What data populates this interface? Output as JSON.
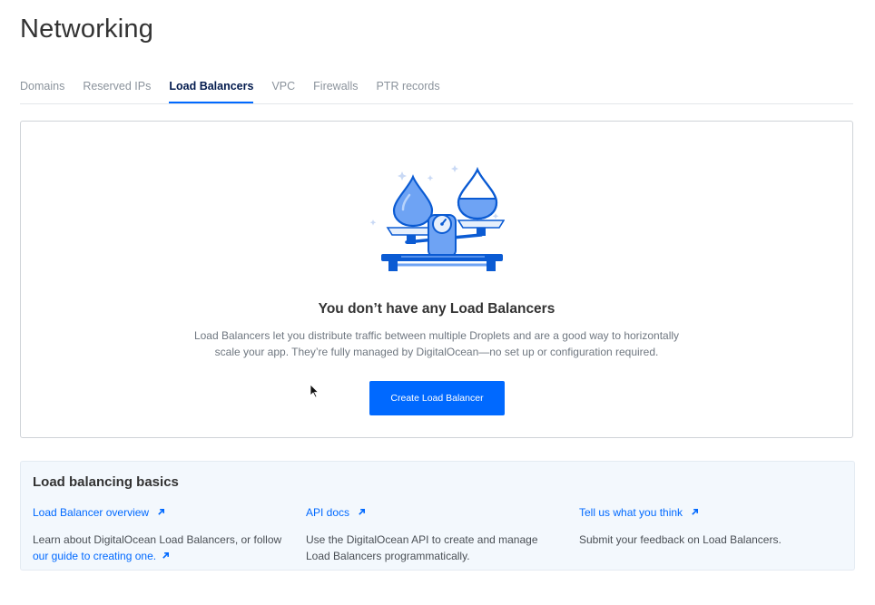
{
  "page": {
    "title": "Networking"
  },
  "tabs": [
    {
      "label": "Domains",
      "active": false
    },
    {
      "label": "Reserved IPs",
      "active": false
    },
    {
      "label": "Load Balancers",
      "active": true
    },
    {
      "label": "VPC",
      "active": false
    },
    {
      "label": "Firewalls",
      "active": false
    },
    {
      "label": "PTR records",
      "active": false
    }
  ],
  "empty_state": {
    "illustration": "balance-scale-droplets-illustration",
    "title": "You don’t have any Load Balancers",
    "description_line1": "Load Balancers let you distribute traffic between multiple Droplets and are a good way to horizontally",
    "description_line2": "scale your app. They’re fully managed by DigitalOcean—no set up or configuration required.",
    "button_label": "Create Load Balancer"
  },
  "basics": {
    "title": "Load balancing basics",
    "columns": [
      {
        "link": "Load Balancer overview",
        "text_before": "Learn about DigitalOcean Load Balancers, or follow",
        "inline_link": "our guide to creating one."
      },
      {
        "link": "API docs",
        "text_line1": "Use the DigitalOcean API to create and manage",
        "text_line2": "Load Balancers programmatically."
      },
      {
        "link": "Tell us what you think",
        "text": "Submit your feedback on Load Balancers."
      }
    ]
  },
  "colors": {
    "accent": "#0069ff",
    "active_tab_text": "#031b4e",
    "muted_text": "#8b939c",
    "card_border": "#cfd3d8",
    "basics_background": "#f3f8fd"
  },
  "icons": {
    "external_link": "arrow-up-right-icon",
    "cursor": "mouse-pointer-icon"
  }
}
